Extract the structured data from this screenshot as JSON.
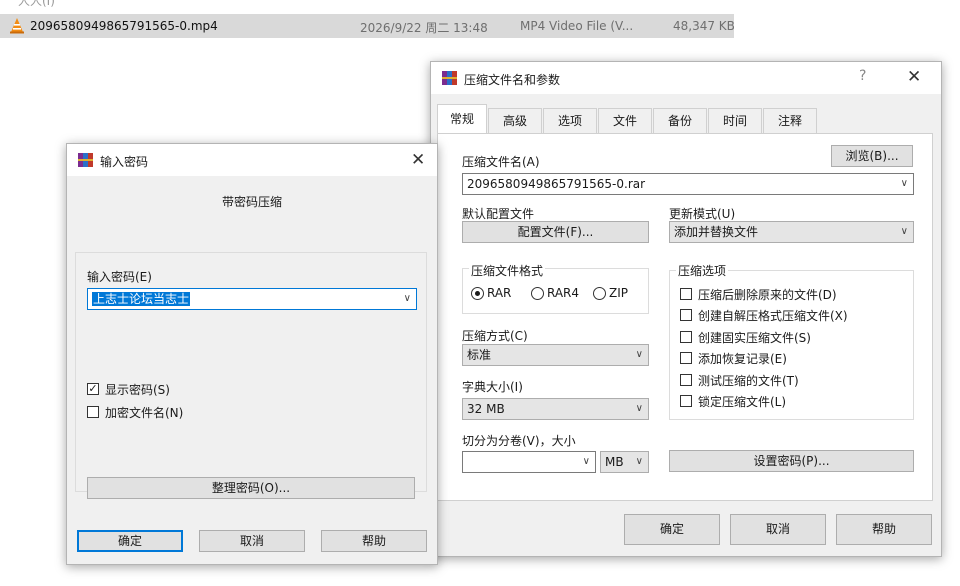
{
  "explorer": {
    "file_name": "2096580949865791565-0.mp4",
    "date": "2026/9/22 周二 13:48",
    "type": "MP4 Video File (V...",
    "size": "48,347 KB"
  },
  "password_dialog": {
    "title": "输入密码",
    "subtitle": "带密码压缩",
    "password_label": "输入密码(E)",
    "password_value": "上志士论坛当志士",
    "show_password": {
      "label": "显示密码(S)",
      "checked": true
    },
    "encrypt_names": {
      "label": "加密文件名(N)",
      "checked": false
    },
    "manage_button": "整理密码(O)...",
    "ok_button": "确定",
    "cancel_button": "取消",
    "help_button": "帮助"
  },
  "archive_dialog": {
    "title": "压缩文件名和参数",
    "help_glyph": "?",
    "tabs": [
      "常规",
      "高级",
      "选项",
      "文件",
      "备份",
      "时间",
      "注释"
    ],
    "active_tab": "常规",
    "archive_name_label": "压缩文件名(A)",
    "browse_button": "浏览(B)...",
    "archive_name_value": "2096580949865791565-0.rar",
    "default_profile_label": "默认配置文件",
    "profile_button": "配置文件(F)...",
    "update_mode_label": "更新模式(U)",
    "update_mode_value": "添加并替换文件",
    "format_group_label": "压缩文件格式",
    "formats": [
      {
        "label": "RAR",
        "selected": true
      },
      {
        "label": "RAR4",
        "selected": false
      },
      {
        "label": "ZIP",
        "selected": false
      }
    ],
    "method_label": "压缩方式(C)",
    "method_value": "标准",
    "dict_label": "字典大小(I)",
    "dict_value": "32 MB",
    "split_label": "切分为分卷(V)，大小",
    "split_value": "",
    "split_unit": "MB",
    "options_group_label": "压缩选项",
    "options": [
      {
        "label": "压缩后删除原来的文件(D)",
        "checked": false
      },
      {
        "label": "创建自解压格式压缩文件(X)",
        "checked": false
      },
      {
        "label": "创建固实压缩文件(S)",
        "checked": false
      },
      {
        "label": "添加恢复记录(E)",
        "checked": false
      },
      {
        "label": "测试压缩的文件(T)",
        "checked": false
      },
      {
        "label": "锁定压缩文件(L)",
        "checked": false
      }
    ],
    "set_password_button": "设置密码(P)...",
    "ok_button": "确定",
    "cancel_button": "取消",
    "help_button": "帮助"
  }
}
